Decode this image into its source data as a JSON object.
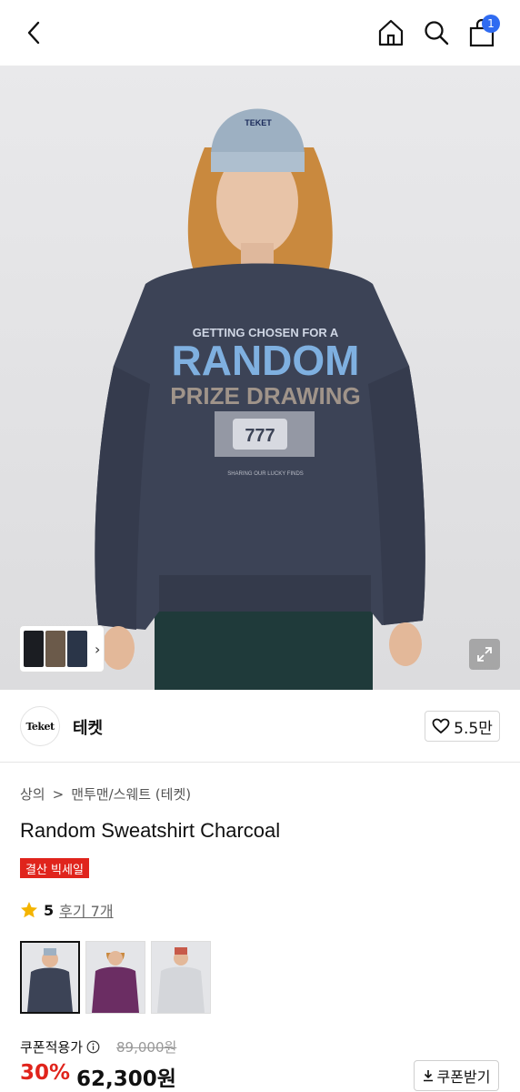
{
  "header": {
    "back_icon": "chevron-left-icon",
    "home_icon": "home-icon",
    "search_icon": "search-icon",
    "cart_icon": "shopping-bag-icon",
    "cart_count": "1"
  },
  "hero": {
    "sweatshirt_print": {
      "line1": "GETTING CHOSEN FOR A",
      "line2": "RANDOM",
      "line3": "PRIZE DRAWING",
      "line4": "SHARING OUR LUCKY FINDS",
      "slot": "777"
    },
    "beanie_text": "TEKET",
    "expand_icon": "expand-icon",
    "thumbs_chevron": "›"
  },
  "brand": {
    "logo_text": "Teket",
    "name": "테켓",
    "like_icon": "heart-icon",
    "like_count": "5.5만"
  },
  "product": {
    "breadcrumb": [
      "상의",
      "맨투맨/스웨트 (테켓)"
    ],
    "breadcrumb_sep": ">",
    "title": "Random Sweatshirt Charcoal",
    "sale_badge": "결산 빅세일",
    "rating_score": "5",
    "reviews_label": "후기 7개",
    "swatches": [
      "charcoal",
      "purple",
      "gray"
    ],
    "price_label": "쿠폰적용가",
    "original_price": "89,000원",
    "discount": "30%",
    "price": "62,300원",
    "coupon_button": "쿠폰받기"
  },
  "colors": {
    "accent": "#e0241c",
    "badge_blue": "#2f6bf1",
    "sweatshirt": "#3c4356",
    "print_blue": "#7fb0e0"
  }
}
